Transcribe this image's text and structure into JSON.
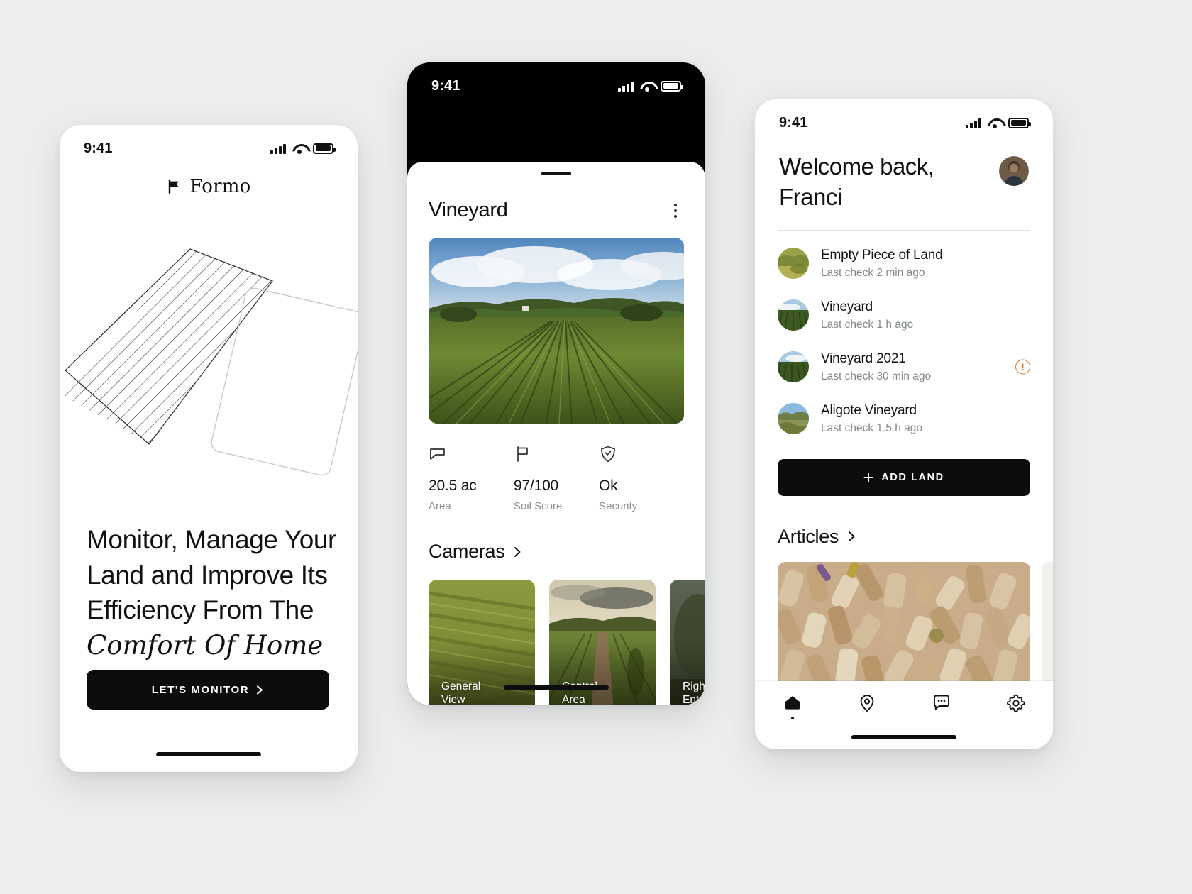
{
  "meta": {
    "background": "#eceded",
    "accent_black": "#0c0c0c",
    "alert_orange": "#e2741e",
    "muted_text": "#83888b"
  },
  "onboarding": {
    "status": {
      "time": "9:41",
      "signal_icon": "cellular-bars-icon",
      "wifi_icon": "wifi-icon",
      "battery_icon": "battery-icon"
    },
    "brand": {
      "logo_icon": "flag-logo-icon",
      "name": "Formo"
    },
    "artwork_name": "hatched-rotated-rectangles-illustration",
    "headline_line1": "Monitor, Manage Your",
    "headline_line2": "Land and Improve Its",
    "headline_line3": "Efficiency From The",
    "headline_emphasis": "Comfort Of Home",
    "cta_label": "LET'S MONITOR",
    "cta_icon": "chevron-right-icon"
  },
  "detail": {
    "status": {
      "time": "9:41",
      "signal_icon": "cellular-bars-icon",
      "wifi_icon": "wifi-icon",
      "battery_icon": "battery-icon"
    },
    "title": "Vineyard",
    "menu_icon": "kebab-menu-icon",
    "hero_image_name": "vineyard-rows-aerial-photo",
    "stats": [
      {
        "icon": "land-area-icon",
        "value": "20.5 ac",
        "label": "Area"
      },
      {
        "icon": "flag-icon",
        "value": "97/100",
        "label": "Soil Score"
      },
      {
        "icon": "shield-check-icon",
        "value": "Ok",
        "label": "Security"
      }
    ],
    "cameras_section": {
      "title": "Cameras",
      "chevron_icon": "chevron-right-icon"
    },
    "cameras": [
      {
        "label_line1": "General",
        "label_line2": "View",
        "image_name": "camera-general-view-photo"
      },
      {
        "label_line1": "Central",
        "label_line2": "Area",
        "image_name": "camera-central-area-photo"
      },
      {
        "label_line1": "Right",
        "label_line2": "Entrance",
        "image_name": "camera-right-entrance-photo"
      }
    ]
  },
  "home": {
    "status": {
      "time": "9:41",
      "signal_icon": "cellular-bars-icon",
      "wifi_icon": "wifi-icon",
      "battery_icon": "battery-icon"
    },
    "greeting_line1": "Welcome back,",
    "greeting_line2": "Franci",
    "avatar_name": "user-avatar-photo",
    "lands": [
      {
        "name": "Empty Piece of Land",
        "last_check": "Last check 2 min ago",
        "thumb": "empty-land-thumb",
        "alert": false
      },
      {
        "name": "Vineyard",
        "last_check": "Last check 1 h ago",
        "thumb": "vineyard-thumb",
        "alert": false
      },
      {
        "name": "Vineyard 2021",
        "last_check": "Last check 30 min ago",
        "thumb": "vineyard-2021-thumb",
        "alert": true,
        "alert_icon": "alert-exclamation-icon",
        "alert_glyph": "!"
      },
      {
        "name": "Aligote Vineyard",
        "last_check": "Last check 1.5 h ago",
        "thumb": "aligote-vineyard-thumb",
        "alert": false
      }
    ],
    "add_land": {
      "label": "ADD LAND",
      "icon": "plus-icon"
    },
    "articles_section": {
      "title": "Articles",
      "chevron_icon": "chevron-right-icon"
    },
    "articles": [
      {
        "image_name": "wine-corks-photo"
      }
    ],
    "tabs": [
      {
        "name": "home",
        "icon": "home-icon",
        "active": true
      },
      {
        "name": "map",
        "icon": "location-pin-icon",
        "active": false
      },
      {
        "name": "messages",
        "icon": "chat-bubble-icon",
        "active": false
      },
      {
        "name": "settings",
        "icon": "gear-icon",
        "active": false
      }
    ]
  }
}
